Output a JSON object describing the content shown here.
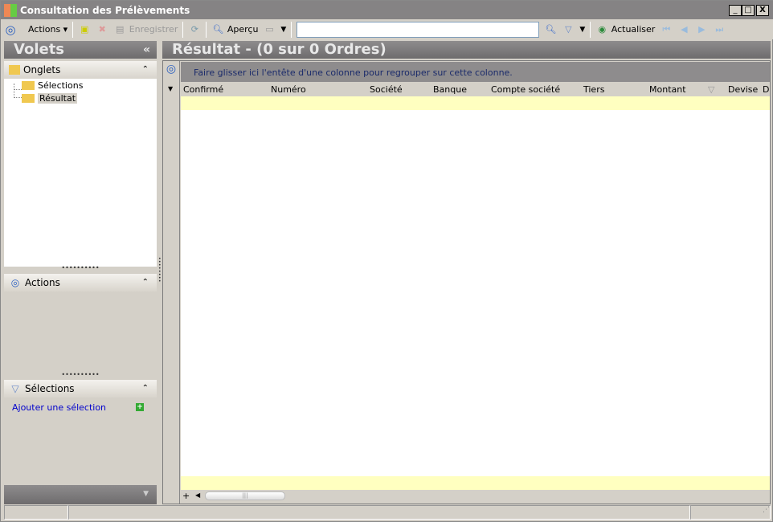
{
  "window": {
    "title": "Consultation des Prélèvements",
    "minimize": "_",
    "maximize": "□",
    "close": "X"
  },
  "toolbar": {
    "actions_label": "Actions",
    "save_label": "Enregistrer",
    "preview_label": "Aperçu",
    "search_value": "",
    "refresh_label": "Actualiser"
  },
  "left_pane": {
    "title": "Volets",
    "collapse": "«",
    "onglets": {
      "label": "Onglets",
      "items": [
        {
          "label": "Sélections"
        },
        {
          "label": "Résultat",
          "selected": true
        }
      ]
    },
    "actions": {
      "label": "Actions"
    },
    "selections": {
      "label": "Sélections",
      "add_link": "Ajouter une sélection"
    }
  },
  "result": {
    "title": "Résultat - (0 sur 0 Ordres)",
    "group_hint": "Faire glisser ici l'entête d'une colonne pour regrouper sur cette colonne.",
    "columns": [
      "Confirmé",
      "Numéro",
      "Société",
      "Banque",
      "Compte société",
      "Tiers",
      "Montant",
      "Devise",
      "D"
    ]
  },
  "colors": {
    "titlebar": "#858384",
    "highlight_row": "#ffffc0",
    "link": "#0000cc",
    "hint_text": "#1a2a6a"
  }
}
